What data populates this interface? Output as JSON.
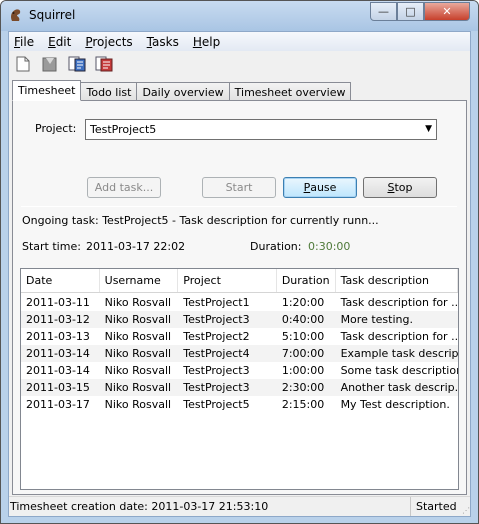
{
  "window": {
    "title": "Squirrel",
    "minimize_glyph": "—",
    "maximize_glyph": "□",
    "close_glyph": "✕"
  },
  "menu": {
    "file": {
      "mnemonic": "F",
      "rest": "ile"
    },
    "edit": {
      "mnemonic": "E",
      "rest": "dit"
    },
    "projects": {
      "mnemonic": "P",
      "rest": "rojects"
    },
    "tasks": {
      "mnemonic": "T",
      "rest": "asks"
    },
    "help": {
      "mnemonic": "H",
      "rest": "elp"
    }
  },
  "toolbar": {
    "icons": [
      "new-document-icon",
      "open-document-icon",
      "export-icon",
      "report-icon"
    ]
  },
  "tabs": [
    "Timesheet",
    "Todo list",
    "Daily overview",
    "Timesheet overview"
  ],
  "form": {
    "project_label": "Project:",
    "project_value": "TestProject5",
    "add_task_label": "Add task...",
    "start_label": "Start",
    "pause_prefix": "",
    "pause_mnemonic": "P",
    "pause_rest": "ause",
    "stop_mnemonic": "S",
    "stop_rest": "top"
  },
  "ongoing": {
    "text": "Ongoing task: TestProject5 - Task description for currently runn...",
    "start_label": "Start time:",
    "start_value": "2011-03-17 22:02",
    "duration_label": "Duration:",
    "duration_value": "0:30:00",
    "duration_color": "#4f7a3a"
  },
  "table": {
    "columns": [
      "Date",
      "Username",
      "Project",
      "Duration",
      "Task description"
    ],
    "rows": [
      [
        "2011-03-11",
        "Niko Rosvall",
        "TestProject1",
        "1:20:00",
        "Task description for ..."
      ],
      [
        "2011-03-12",
        "Niko Rosvall",
        "TestProject3",
        "0:40:00",
        "More testing."
      ],
      [
        "2011-03-13",
        "Niko Rosvall",
        "TestProject2",
        "5:10:00",
        "Task description for ..."
      ],
      [
        "2011-03-14",
        "Niko Rosvall",
        "TestProject4",
        "7:00:00",
        "Example task descrip..."
      ],
      [
        "2011-03-14",
        "Niko Rosvall",
        "TestProject3",
        "1:00:00",
        "Some task description."
      ],
      [
        "2011-03-15",
        "Niko Rosvall",
        "TestProject3",
        "2:30:00",
        "Another task descrip..."
      ],
      [
        "2011-03-17",
        "Niko Rosvall",
        "TestProject5",
        "2:15:00",
        "My Test description."
      ]
    ]
  },
  "status": {
    "left": "Timesheet creation date: 2011-03-17 21:53:10",
    "right": "Started"
  }
}
